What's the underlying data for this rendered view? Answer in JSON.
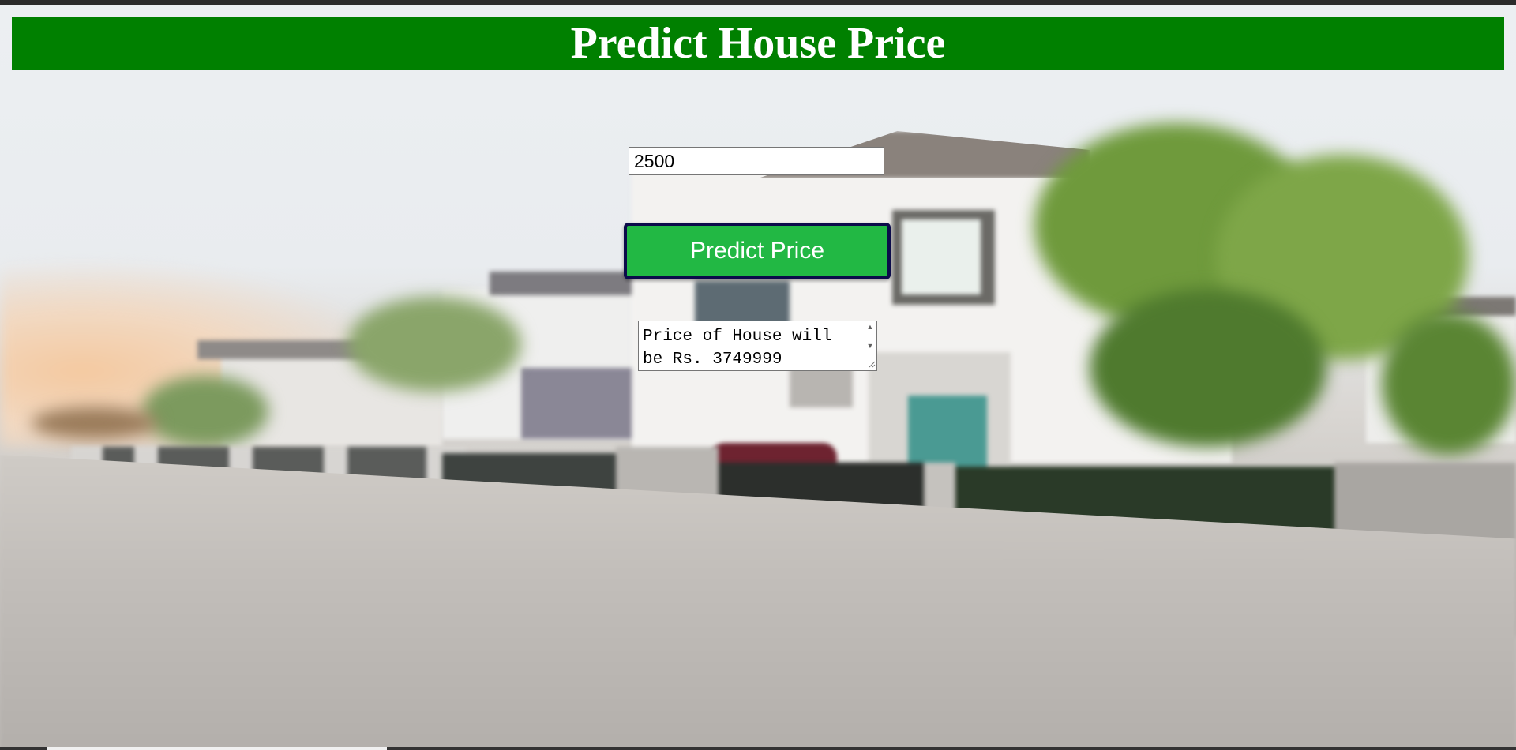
{
  "page": {
    "title": "Predict House Price"
  },
  "form": {
    "area_value": "2500",
    "predict_label": "Predict Price",
    "result_text": "Price of House will be Rs. 3749999"
  },
  "colors": {
    "header_bg": "#008000",
    "button_bg": "#22b844",
    "button_border": "#0b0b4a"
  },
  "icons": {
    "scroll_up": "scroll-up-arrow-icon",
    "scroll_down": "scroll-down-arrow-icon",
    "resize": "resize-grip-icon"
  }
}
